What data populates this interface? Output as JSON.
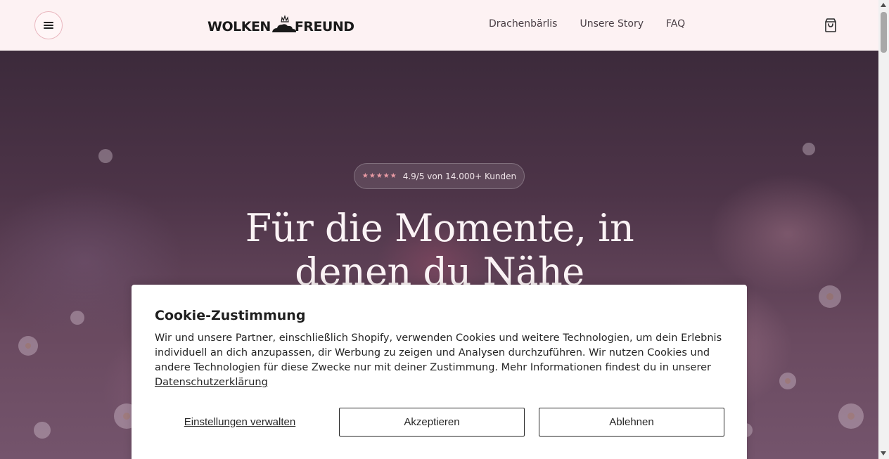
{
  "header": {
    "menu_icon": "hamburger-menu-icon",
    "logo": {
      "left_text": "WOLKEN",
      "right_text": "FREUND",
      "mark_icon": "cloud-crown-icon"
    },
    "nav": [
      {
        "label": "Drachenbärlis"
      },
      {
        "label": "Unsere Story"
      },
      {
        "label": "FAQ"
      }
    ],
    "cart_icon": "shopping-bag-icon",
    "background_color": "#fdf2f3"
  },
  "hero": {
    "rating": {
      "stars": "★★★★★",
      "text": "4.9/5 von 14.000+ Kunden"
    },
    "title": "Für die Momente, in denen du Nähe"
  },
  "cookie_banner": {
    "title": "Cookie-Zustimmung",
    "text": "Wir und unsere Partner, einschließlich Shopify, verwenden Cookies und weitere Technologien, um dein Erlebnis individuell an dich anzupassen, dir Werbung zu zeigen und Analysen durchzuführen. Wir nutzen Cookies und andere Technologien für diese Zwecke nur mit deiner Zustimmung. Mehr Informationen findest du in unserer",
    "privacy_link": "Datenschutzerklärung",
    "manage_label": "Einstellungen verwalten",
    "accept_label": "Akzeptieren",
    "decline_label": "Ablehnen"
  }
}
